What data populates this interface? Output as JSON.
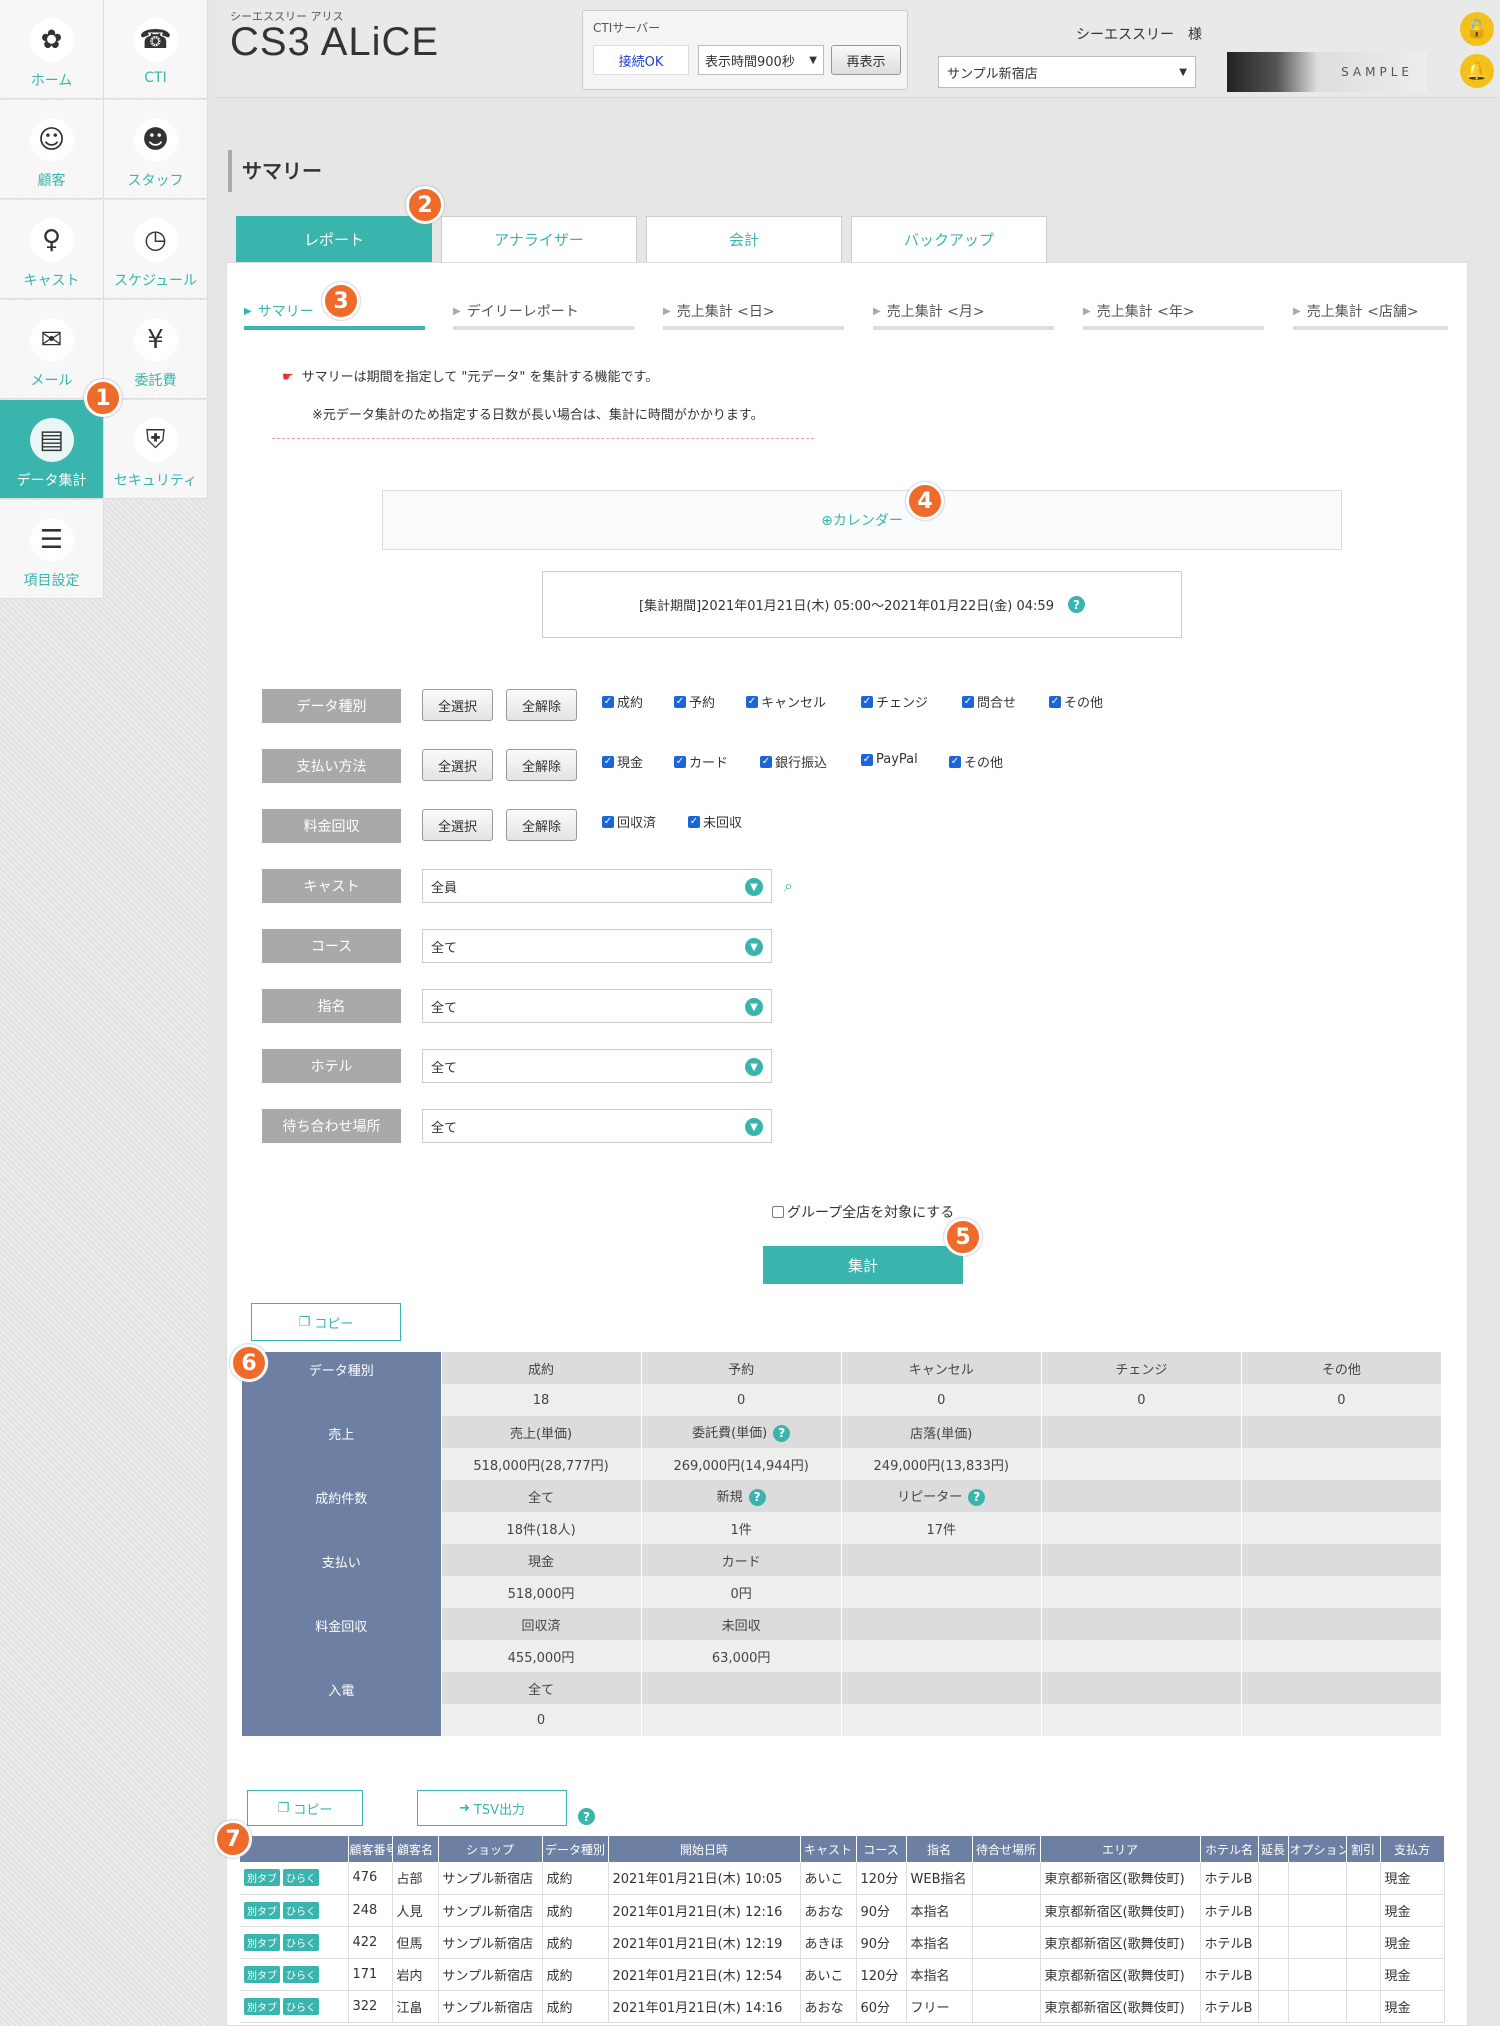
{
  "sidebar": {
    "items": [
      {
        "label": "ホーム",
        "icon": "home-icon",
        "glyph": "✿"
      },
      {
        "label": "CTI",
        "icon": "phone-icon",
        "glyph": "☎"
      },
      {
        "label": "顧客",
        "icon": "customer-icon",
        "glyph": "☺"
      },
      {
        "label": "スタッフ",
        "icon": "staff-icon",
        "glyph": "☻"
      },
      {
        "label": "キャスト",
        "icon": "cast-icon",
        "glyph": "♀"
      },
      {
        "label": "スケジュール",
        "icon": "clock-icon",
        "glyph": "◷"
      },
      {
        "label": "メール",
        "icon": "mail-icon",
        "glyph": "✉"
      },
      {
        "label": "委託費",
        "icon": "commission-icon",
        "glyph": "¥"
      },
      {
        "label": "データ集計",
        "icon": "data-icon",
        "glyph": "▤"
      },
      {
        "label": "セキュリティ",
        "icon": "shield-icon",
        "glyph": "⛨"
      },
      {
        "label": "項目設定",
        "icon": "clipboard-icon",
        "glyph": "☰"
      }
    ]
  },
  "header": {
    "brand_sub": "シーエススリー アリス",
    "brand_title": "CS3 ALiCE",
    "cti_label": "CTIサーバー",
    "cti_status": "接続OK",
    "cti_interval": "表示時間900秒",
    "cti_refresh": "再表示",
    "user": "シーエススリー　様",
    "store": "サンプル新宿店",
    "banner": "SAMPLE",
    "lock_glyph": "🔓",
    "bell_glyph": "🔔"
  },
  "page": {
    "title": "サマリー"
  },
  "tabs": [
    "レポート",
    "アナライザー",
    "会計",
    "バックアップ"
  ],
  "subtabs": [
    "サマリー",
    "デイリーレポート",
    "売上集計 <日>",
    "売上集計 <月>",
    "売上集計 <年>",
    "売上集計 <店舗>"
  ],
  "badges": [
    "1",
    "2",
    "3",
    "4",
    "5",
    "6",
    "7"
  ],
  "notice": {
    "line1": "サマリーは期間を指定して \"元データ\" を集計する機能です。",
    "line2": "※元データ集計のため指定する日数が長い場合は、集計に時間がかかります。"
  },
  "calendar": {
    "label": "⊕カレンダー"
  },
  "period": {
    "text": "[集計期間]2021年01月21日(木) 05:00〜2021年01月22日(金) 04:59"
  },
  "filters": {
    "select_all": "全選択",
    "clear_all": "全解除",
    "data_type": {
      "label": "データ種別",
      "options": [
        "成約",
        "予約",
        "キャンセル",
        "チェンジ",
        "問合せ",
        "その他"
      ]
    },
    "payment": {
      "label": "支払い方法",
      "options": [
        "現金",
        "カード",
        "銀行振込",
        "PayPal",
        "その他"
      ]
    },
    "collection": {
      "label": "料金回収",
      "options": [
        "回収済",
        "未回収"
      ]
    },
    "cast": {
      "label": "キャスト",
      "value": "全員"
    },
    "course": {
      "label": "コース",
      "value": "全て"
    },
    "nomination": {
      "label": "指名",
      "value": "全て"
    },
    "hotel": {
      "label": "ホテル",
      "value": "全て"
    },
    "meeting": {
      "label": "待ち合わせ場所",
      "value": "全て"
    }
  },
  "group_label": "グループ全店を対象にする",
  "submit": "集計",
  "copy": "コピー",
  "summary": {
    "rows": [
      {
        "head": "データ種別",
        "labels": [
          "成約",
          "予約",
          "キャンセル",
          "チェンジ",
          "その他"
        ],
        "values": [
          "18",
          "0",
          "0",
          "0",
          "0"
        ]
      },
      {
        "head": "売上",
        "labels": [
          "売上(単価)",
          "委託費(単価)",
          "店落(単価)",
          "",
          ""
        ],
        "values": [
          "518,000円(28,777円)",
          "269,000円(14,944円)",
          "249,000円(13,833円)",
          "",
          ""
        ]
      },
      {
        "head": "成約件数",
        "labels": [
          "全て",
          "新規",
          "リピーター",
          "",
          ""
        ],
        "values": [
          "18件(18人)",
          "1件",
          "17件",
          "",
          ""
        ]
      },
      {
        "head": "支払い",
        "labels": [
          "現金",
          "カード",
          "",
          "",
          ""
        ],
        "values": [
          "518,000円",
          "0円",
          "",
          "",
          ""
        ]
      },
      {
        "head": "料金回収",
        "labels": [
          "回収済",
          "未回収",
          "",
          "",
          ""
        ],
        "values": [
          "455,000円",
          "63,000円",
          "",
          "",
          ""
        ]
      },
      {
        "head": "入電",
        "labels": [
          "全て",
          "",
          "",
          "",
          ""
        ],
        "values": [
          "0",
          "",
          "",
          "",
          ""
        ]
      }
    ]
  },
  "detail_copy": "コピー",
  "tsv": "TSV出力",
  "detail": {
    "btn_newtab": "別タブ",
    "btn_open": "ひらく",
    "columns": [
      "",
      "顧客番号",
      "顧客名",
      "ショップ",
      "データ種別",
      "開始日時",
      "キャスト",
      "コース",
      "指名",
      "待合せ場所",
      "エリア",
      "ホテル名",
      "延長",
      "オプション",
      "割引",
      "支払方"
    ],
    "rows": [
      [
        "476",
        "占部",
        "サンプル新宿店",
        "成約",
        "2021年01月21日(木) 10:05",
        "あいこ",
        "120分",
        "WEB指名",
        "",
        "東京都新宿区(歌舞伎町)",
        "ホテルB",
        "",
        "",
        "",
        "現金"
      ],
      [
        "248",
        "人見",
        "サンプル新宿店",
        "成約",
        "2021年01月21日(木) 12:16",
        "あおな",
        "90分",
        "本指名",
        "",
        "東京都新宿区(歌舞伎町)",
        "ホテルB",
        "",
        "",
        "",
        "現金"
      ],
      [
        "422",
        "但馬",
        "サンプル新宿店",
        "成約",
        "2021年01月21日(木) 12:19",
        "あきほ",
        "90分",
        "本指名",
        "",
        "東京都新宿区(歌舞伎町)",
        "ホテルB",
        "",
        "",
        "",
        "現金"
      ],
      [
        "171",
        "岩内",
        "サンプル新宿店",
        "成約",
        "2021年01月21日(木) 12:54",
        "あいこ",
        "120分",
        "本指名",
        "",
        "東京都新宿区(歌舞伎町)",
        "ホテルB",
        "",
        "",
        "",
        "現金"
      ],
      [
        "322",
        "江畠",
        "サンプル新宿店",
        "成約",
        "2021年01月21日(木) 14:16",
        "あおな",
        "60分",
        "フリー",
        "",
        "東京都新宿区(歌舞伎町)",
        "ホテルB",
        "",
        "",
        "",
        "現金"
      ]
    ]
  },
  "colors": {
    "accent": "#3ab5ad",
    "table_head": "#6d7fa3",
    "badge": "#ee6b2c"
  }
}
